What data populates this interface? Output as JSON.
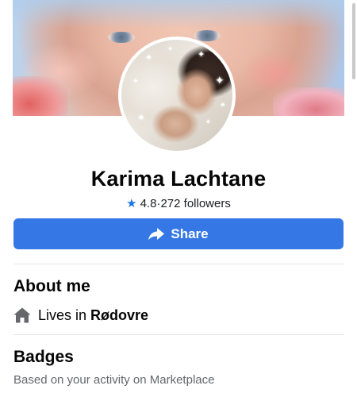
{
  "profile": {
    "name": "Karima Lachtane",
    "rating": "4.8",
    "separator": "·",
    "followers": "272 followers"
  },
  "actions": {
    "share_label": "Share"
  },
  "about": {
    "title": "About me",
    "lives_prefix": "Lives in",
    "city": "Rødovre"
  },
  "badges": {
    "title": "Badges",
    "subtitle": "Based on your activity on Marketplace"
  },
  "icons": {
    "rating": "star-icon",
    "share": "share-arrow-icon",
    "home": "home-icon"
  },
  "colors": {
    "accent": "#3578e5",
    "star": "#1b74e4",
    "secondary_text": "#65676b"
  }
}
